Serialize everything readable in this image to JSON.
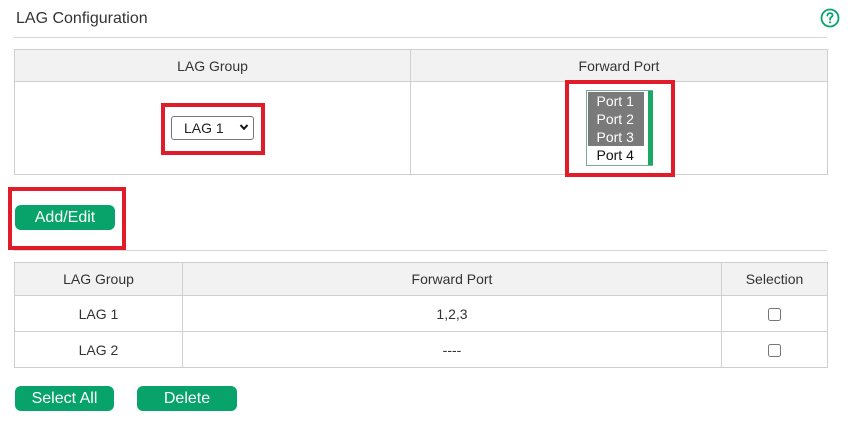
{
  "header": {
    "title": "LAG Configuration",
    "help_icon": "question-circle-icon"
  },
  "config": {
    "col_group": "LAG Group",
    "col_port": "Forward Port",
    "lag_options": [
      "LAG 1"
    ],
    "lag_selected": "LAG 1",
    "ports": [
      {
        "label": "Port 1",
        "selected": true
      },
      {
        "label": "Port 2",
        "selected": true
      },
      {
        "label": "Port 3",
        "selected": true
      },
      {
        "label": "Port 4",
        "selected": false
      }
    ]
  },
  "add_edit_label": "Add/Edit",
  "list": {
    "headers": {
      "group": "LAG Group",
      "port": "Forward Port",
      "selection": "Selection"
    },
    "rows": [
      {
        "group": "LAG 1",
        "ports": "1,2,3"
      },
      {
        "group": "LAG 2",
        "ports": "----"
      }
    ]
  },
  "buttons": {
    "select_all": "Select All",
    "delete": "Delete"
  },
  "colors": {
    "accent": "#08a36a",
    "highlight": "#e21b2a"
  }
}
